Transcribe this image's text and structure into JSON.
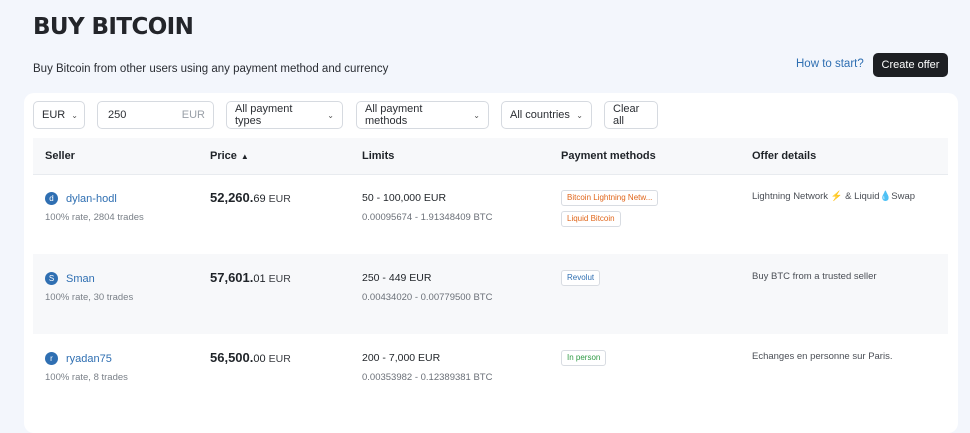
{
  "header": {
    "title": "BUY BITCOIN",
    "subtitle": "Buy Bitcoin from other users using any payment method and currency",
    "how_to_start": "How to start?",
    "create_offer": "Create offer"
  },
  "filters": {
    "currency": "EUR",
    "amount": "250",
    "amount_unit": "EUR",
    "payment_types": "All payment types",
    "payment_methods": "All payment methods",
    "countries": "All countries",
    "clear_all": "Clear all"
  },
  "table": {
    "columns": [
      "Seller",
      "Price",
      "Limits",
      "Payment methods",
      "Offer details"
    ],
    "rows": [
      {
        "avatar": "d",
        "seller": "dylan-hodl",
        "stats": "100% rate, 2804 trades",
        "price_main": "52,260.",
        "price_cents": "69",
        "currency": "EUR",
        "limit": "50 - 100,000 EUR",
        "limit_btc": "0.00095674 - 1.91348409 BTC",
        "methods": [
          {
            "label": "Bitcoin Lightning Netw...",
            "color": "#e0661b"
          },
          {
            "label": "Liquid Bitcoin",
            "color": "#e0661b"
          }
        ],
        "details": "Lightning Network ⚡ & Liquid💧Swap"
      },
      {
        "avatar": "S",
        "seller": "Sman",
        "stats": "100% rate, 30 trades",
        "price_main": "57,601.",
        "price_cents": "01",
        "currency": "EUR",
        "limit": "250 - 449 EUR",
        "limit_btc": "0.00434020 - 0.00779500 BTC",
        "methods": [
          {
            "label": "Revolut",
            "color": "#2f6fb2"
          }
        ],
        "details": "Buy BTC from a trusted seller"
      },
      {
        "avatar": "r",
        "seller": "ryadan75",
        "stats": "100% rate, 8 trades",
        "price_main": "56,500.",
        "price_cents": "00",
        "currency": "EUR",
        "limit": "200 - 7,000 EUR",
        "limit_btc": "0.00353982 - 0.12389381 BTC",
        "methods": [
          {
            "label": "In person",
            "color": "#2f9a45"
          }
        ],
        "details": "Echanges en personne sur Paris."
      }
    ]
  }
}
